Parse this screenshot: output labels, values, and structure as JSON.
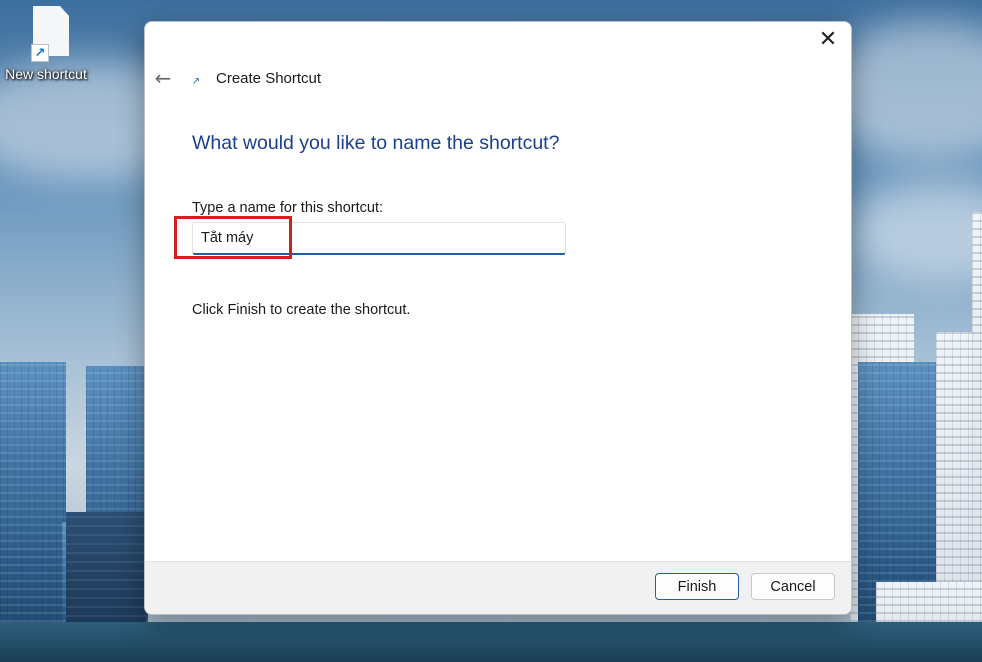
{
  "desktop": {
    "shortcut_label": "New shortcut",
    "shortcut_badge": "↗"
  },
  "dialog": {
    "title": "Create Shortcut",
    "close_glyph": "✕",
    "back_glyph": "←",
    "title_icon_glyph": "↗",
    "heading": "What would you like to name the shortcut?",
    "field_label": "Type a name for this shortcut:",
    "name_value": "Tắt máy",
    "finish_note": "Click Finish to create the shortcut.",
    "finish_label": "Finish",
    "cancel_label": "Cancel"
  },
  "colors": {
    "heading": "#1b3f8f",
    "input_accent": "#1e5fa8",
    "highlight": "#d0201f"
  }
}
